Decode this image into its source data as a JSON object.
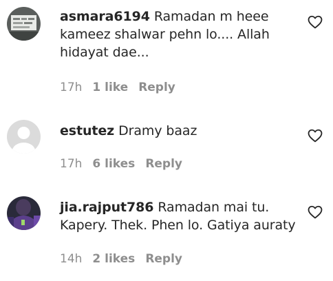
{
  "comments": [
    {
      "username": "asmara6194",
      "text": "Ramadan m heee kameez shalwar pehn lo.... Allah hidayat dae...",
      "time": "17h",
      "likes": "1 like",
      "reply": "Reply",
      "like_icon": "heart-outline-icon"
    },
    {
      "username": "estutez",
      "text": "Dramy baaz",
      "time": "17h",
      "likes": "6 likes",
      "reply": "Reply",
      "like_icon": "heart-outline-icon"
    },
    {
      "username": "jia.rajput786",
      "text": "Ramadan mai tu. Kapery. Thek. Phen lo. Gatiya auraty",
      "time": "14h",
      "likes": "2 likes",
      "reply": "Reply",
      "like_icon": "heart-outline-icon"
    }
  ],
  "colors": {
    "text": "#262626",
    "secondary": "#8e8e8e",
    "default_avatar_bg": "#dbdbdb"
  }
}
